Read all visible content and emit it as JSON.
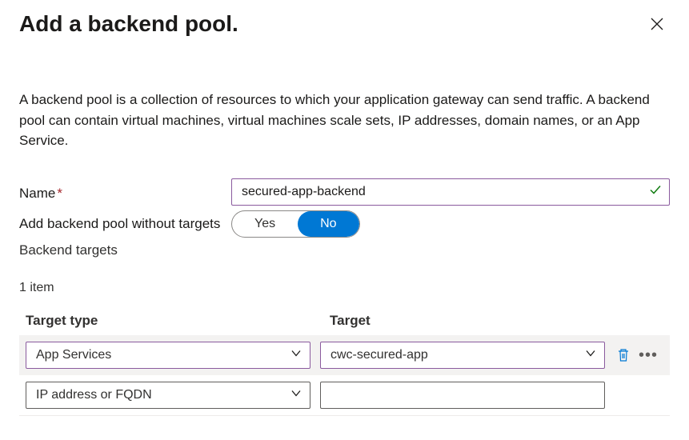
{
  "header": {
    "title": "Add a backend pool."
  },
  "description": "A backend pool is a collection of resources to which your application gateway can send traffic. A backend pool can contain virtual machines, virtual machines scale sets, IP addresses, domain names, or an App Service.",
  "form": {
    "name_label": "Name",
    "name_value": "secured-app-backend",
    "no_targets_label": "Add backend pool without targets",
    "toggle_yes": "Yes",
    "toggle_no": "No",
    "targets_label": "Backend targets",
    "count_text": "1 item"
  },
  "targets": {
    "col_type": "Target type",
    "col_target": "Target",
    "rows": [
      {
        "type": "App Services",
        "target": "cwc-secured-app"
      },
      {
        "type": "IP address or FQDN",
        "target": ""
      }
    ]
  }
}
